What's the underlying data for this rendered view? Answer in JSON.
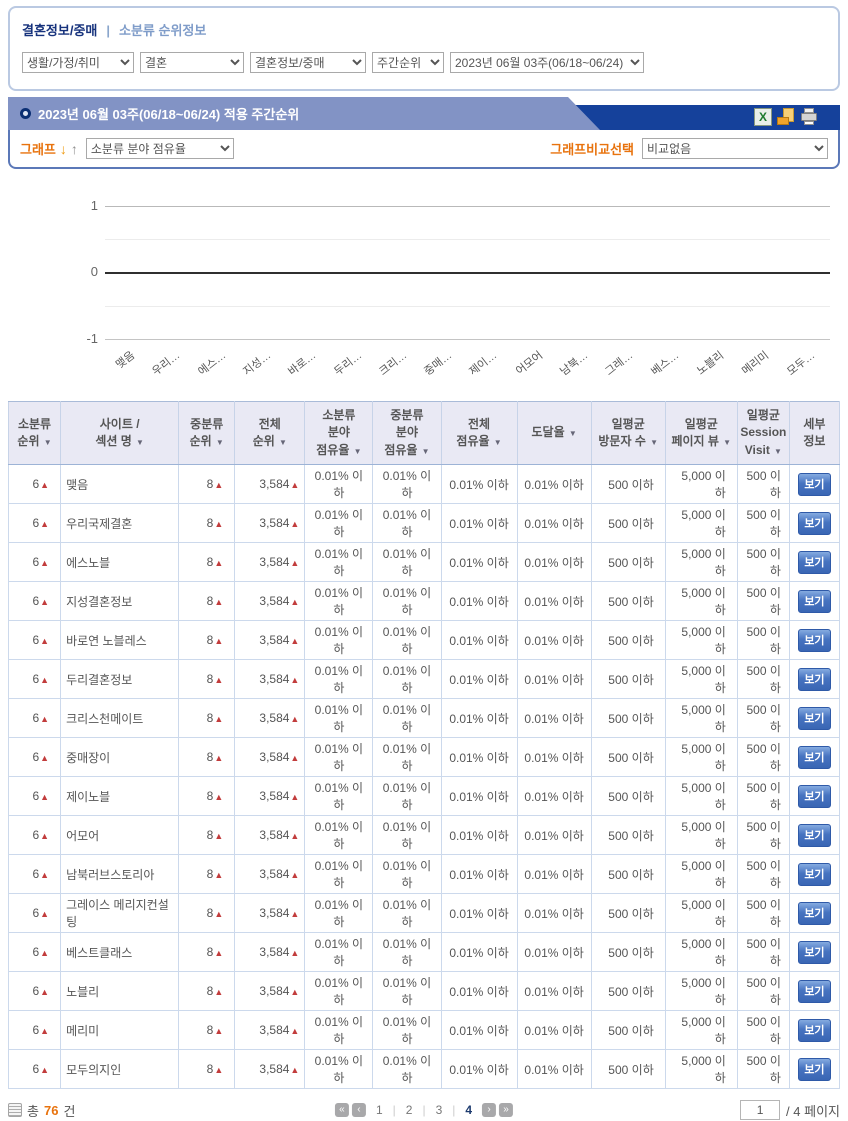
{
  "colors": {
    "accent_orange": "#e8730e",
    "navy_bar": "#15419b",
    "tab_blue": "#8293c5",
    "link_blue": "#7f9cc9",
    "rank_up_red": "#c23c3c",
    "table_header_bg": "#e9e9f4"
  },
  "breadcrumb": {
    "title": "결혼정보/중매",
    "separator": "|",
    "subtitle": "소분류 순위정보"
  },
  "filters": {
    "category_group": "생활/가정/취미",
    "category_mid": "결혼",
    "category_small": "결혼정보/중매",
    "period_type": "주간순위",
    "period": "2023년  06월  03주(06/18~06/24)"
  },
  "panel": {
    "title": "2023년  06월  03주(06/18~06/24) 적용 주간순위",
    "excel_glyph": "X",
    "graph_label": "그래프",
    "graph_arrow_down": "↓",
    "graph_arrow_up": "↑",
    "graph_metric": "소분류 분야 점유율",
    "compare_label": "그래프비교선택",
    "compare_value": "비교없음"
  },
  "chart_data": {
    "type": "bar",
    "title": "소분류 분야 점유율",
    "categories": [
      "맺음",
      "우리…",
      "에스…",
      "지성…",
      "바로…",
      "두리…",
      "크리…",
      "중매…",
      "제이…",
      "어모어",
      "남북…",
      "그레…",
      "베스…",
      "노블리",
      "메리미",
      "모두…"
    ],
    "series": [
      {
        "name": "소분류 분야 점유율",
        "values": [
          0,
          0,
          0,
          0,
          0,
          0,
          0,
          0,
          0,
          0,
          0,
          0,
          0,
          0,
          0,
          0
        ]
      }
    ],
    "ylim": [
      -1,
      1
    ],
    "yticks": [
      "1",
      "0",
      "-1"
    ],
    "grid": true,
    "legend_position": "none"
  },
  "table": {
    "sort_icon": "▼",
    "up_arrow": "▲",
    "detail_button": "보기",
    "headers": [
      {
        "label": "소분류\n순위",
        "sort": true
      },
      {
        "label": "사이트 /\n섹션 명",
        "sort": true
      },
      {
        "label": "중분류\n순위",
        "sort": true
      },
      {
        "label": "전체\n순위",
        "sort": true
      },
      {
        "label": "소분류\n분야\n점유율",
        "sort": true
      },
      {
        "label": "중분류\n분야\n점유율",
        "sort": true
      },
      {
        "label": "전체\n점유율",
        "sort": true
      },
      {
        "label": "도달율",
        "sort": true
      },
      {
        "label": "일평균\n방문자 수",
        "sort": true
      },
      {
        "label": "일평균\n페이지 뷰",
        "sort": true
      },
      {
        "label": "일평균\nSession\nVisit",
        "sort": true
      },
      {
        "label": "세부\n정보",
        "sort": false
      }
    ],
    "rows": [
      {
        "rank": "6",
        "name": "맺음",
        "mid_rank": "8",
        "total_rank": "3,584",
        "share_small": "0.01% 이하",
        "share_mid": "0.01% 이하",
        "share_total": "0.01% 이하",
        "reach": "0.01% 이하",
        "visitors": "500 이하",
        "pageviews": "5,000 이하",
        "session": "500 이하"
      },
      {
        "rank": "6",
        "name": "우리국제결혼",
        "mid_rank": "8",
        "total_rank": "3,584",
        "share_small": "0.01% 이하",
        "share_mid": "0.01% 이하",
        "share_total": "0.01% 이하",
        "reach": "0.01% 이하",
        "visitors": "500 이하",
        "pageviews": "5,000 이하",
        "session": "500 이하"
      },
      {
        "rank": "6",
        "name": "에스노블",
        "mid_rank": "8",
        "total_rank": "3,584",
        "share_small": "0.01% 이하",
        "share_mid": "0.01% 이하",
        "share_total": "0.01% 이하",
        "reach": "0.01% 이하",
        "visitors": "500 이하",
        "pageviews": "5,000 이하",
        "session": "500 이하"
      },
      {
        "rank": "6",
        "name": "지성결혼정보",
        "mid_rank": "8",
        "total_rank": "3,584",
        "share_small": "0.01% 이하",
        "share_mid": "0.01% 이하",
        "share_total": "0.01% 이하",
        "reach": "0.01% 이하",
        "visitors": "500 이하",
        "pageviews": "5,000 이하",
        "session": "500 이하"
      },
      {
        "rank": "6",
        "name": "바로연 노블레스",
        "mid_rank": "8",
        "total_rank": "3,584",
        "share_small": "0.01% 이하",
        "share_mid": "0.01% 이하",
        "share_total": "0.01% 이하",
        "reach": "0.01% 이하",
        "visitors": "500 이하",
        "pageviews": "5,000 이하",
        "session": "500 이하"
      },
      {
        "rank": "6",
        "name": "두리결혼정보",
        "mid_rank": "8",
        "total_rank": "3,584",
        "share_small": "0.01% 이하",
        "share_mid": "0.01% 이하",
        "share_total": "0.01% 이하",
        "reach": "0.01% 이하",
        "visitors": "500 이하",
        "pageviews": "5,000 이하",
        "session": "500 이하"
      },
      {
        "rank": "6",
        "name": "크리스천메이트",
        "mid_rank": "8",
        "total_rank": "3,584",
        "share_small": "0.01% 이하",
        "share_mid": "0.01% 이하",
        "share_total": "0.01% 이하",
        "reach": "0.01% 이하",
        "visitors": "500 이하",
        "pageviews": "5,000 이하",
        "session": "500 이하"
      },
      {
        "rank": "6",
        "name": "중매장이",
        "mid_rank": "8",
        "total_rank": "3,584",
        "share_small": "0.01% 이하",
        "share_mid": "0.01% 이하",
        "share_total": "0.01% 이하",
        "reach": "0.01% 이하",
        "visitors": "500 이하",
        "pageviews": "5,000 이하",
        "session": "500 이하"
      },
      {
        "rank": "6",
        "name": "제이노블",
        "mid_rank": "8",
        "total_rank": "3,584",
        "share_small": "0.01% 이하",
        "share_mid": "0.01% 이하",
        "share_total": "0.01% 이하",
        "reach": "0.01% 이하",
        "visitors": "500 이하",
        "pageviews": "5,000 이하",
        "session": "500 이하"
      },
      {
        "rank": "6",
        "name": "어모어",
        "mid_rank": "8",
        "total_rank": "3,584",
        "share_small": "0.01% 이하",
        "share_mid": "0.01% 이하",
        "share_total": "0.01% 이하",
        "reach": "0.01% 이하",
        "visitors": "500 이하",
        "pageviews": "5,000 이하",
        "session": "500 이하"
      },
      {
        "rank": "6",
        "name": "남북러브스토리아",
        "mid_rank": "8",
        "total_rank": "3,584",
        "share_small": "0.01% 이하",
        "share_mid": "0.01% 이하",
        "share_total": "0.01% 이하",
        "reach": "0.01% 이하",
        "visitors": "500 이하",
        "pageviews": "5,000 이하",
        "session": "500 이하"
      },
      {
        "rank": "6",
        "name": "그레이스 메리지컨설팅",
        "mid_rank": "8",
        "total_rank": "3,584",
        "share_small": "0.01% 이하",
        "share_mid": "0.01% 이하",
        "share_total": "0.01% 이하",
        "reach": "0.01% 이하",
        "visitors": "500 이하",
        "pageviews": "5,000 이하",
        "session": "500 이하"
      },
      {
        "rank": "6",
        "name": "베스트클래스",
        "mid_rank": "8",
        "total_rank": "3,584",
        "share_small": "0.01% 이하",
        "share_mid": "0.01% 이하",
        "share_total": "0.01% 이하",
        "reach": "0.01% 이하",
        "visitors": "500 이하",
        "pageviews": "5,000 이하",
        "session": "500 이하"
      },
      {
        "rank": "6",
        "name": "노블리",
        "mid_rank": "8",
        "total_rank": "3,584",
        "share_small": "0.01% 이하",
        "share_mid": "0.01% 이하",
        "share_total": "0.01% 이하",
        "reach": "0.01% 이하",
        "visitors": "500 이하",
        "pageviews": "5,000 이하",
        "session": "500 이하"
      },
      {
        "rank": "6",
        "name": "메리미",
        "mid_rank": "8",
        "total_rank": "3,584",
        "share_small": "0.01% 이하",
        "share_mid": "0.01% 이하",
        "share_total": "0.01% 이하",
        "reach": "0.01% 이하",
        "visitors": "500 이하",
        "pageviews": "5,000 이하",
        "session": "500 이하"
      },
      {
        "rank": "6",
        "name": "모두의지인",
        "mid_rank": "8",
        "total_rank": "3,584",
        "share_small": "0.01% 이하",
        "share_mid": "0.01% 이하",
        "share_total": "0.01% 이하",
        "reach": "0.01% 이하",
        "visitors": "500 이하",
        "pageviews": "5,000 이하",
        "session": "500 이하"
      }
    ]
  },
  "footer": {
    "total_prefix": "총",
    "total_count": "76",
    "total_suffix": "건",
    "pager_icons": {
      "first": "«",
      "prev": "‹",
      "next": "›",
      "last": "»"
    },
    "pages": [
      "1",
      "2",
      "3",
      "4"
    ],
    "current_page": "4",
    "page_separator": "|",
    "page_input": "1",
    "page_total": "/ 4 페이지"
  }
}
